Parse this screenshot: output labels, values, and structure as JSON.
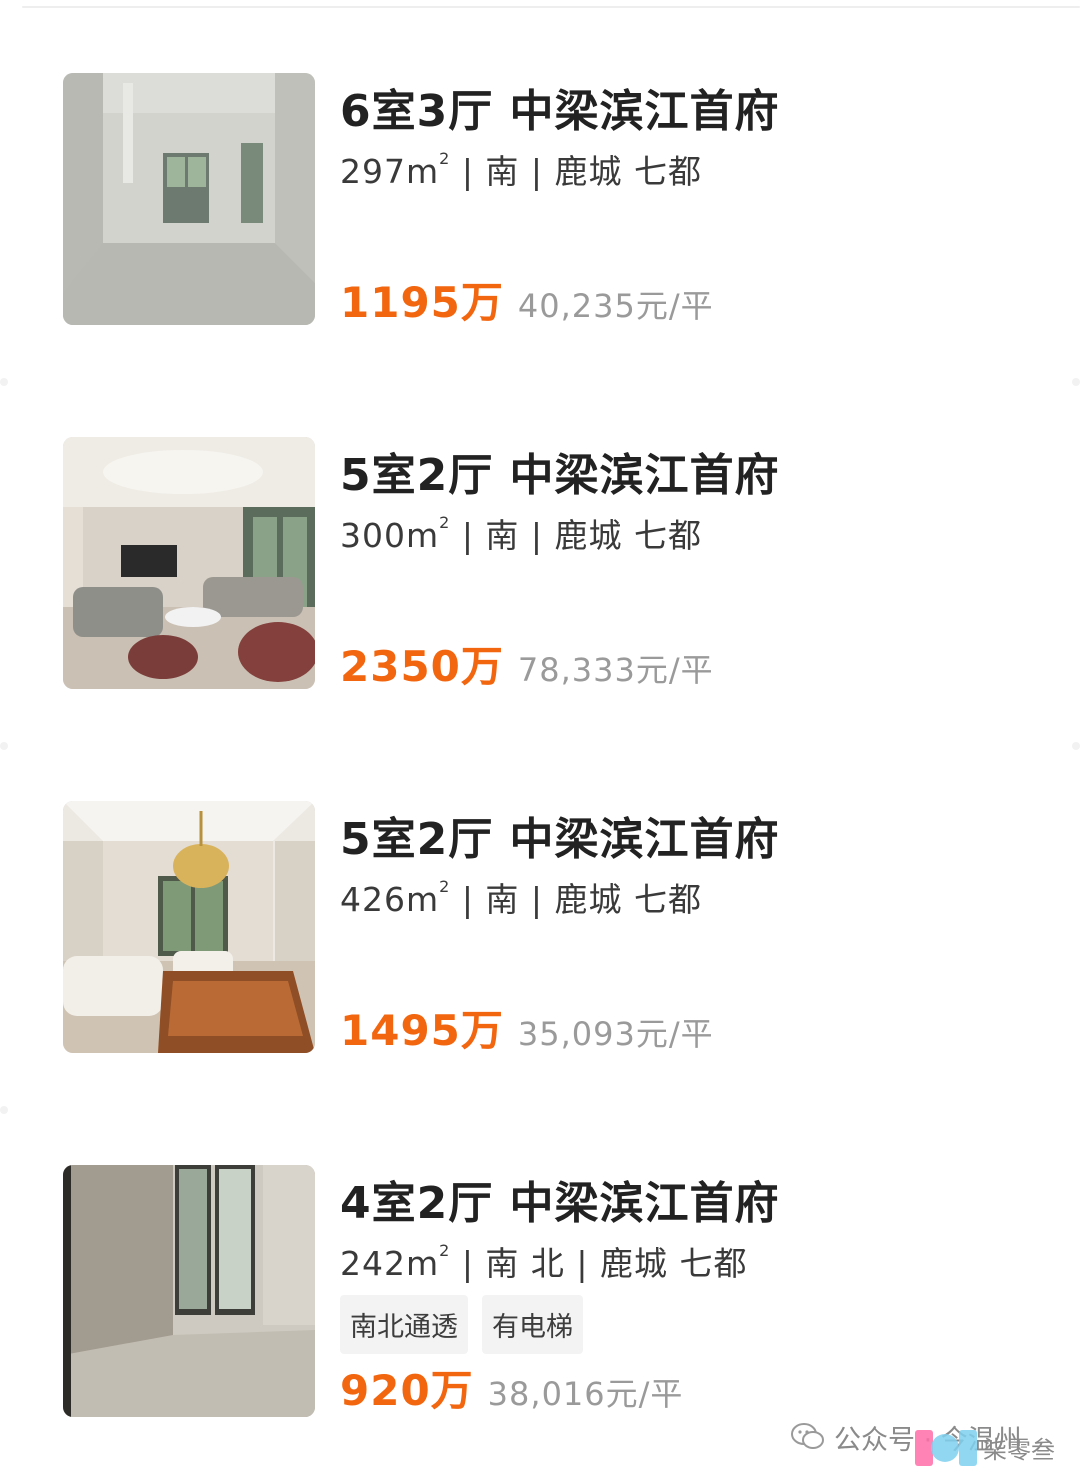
{
  "listings": [
    {
      "title": "6室3厅 中梁滨江首府",
      "area": "297m",
      "area_sup": "2",
      "details": " | 南 | 鹿城 七都",
      "price": "1195万",
      "unit_price": "40,235元/平",
      "photo": "empty-unfinished-room"
    },
    {
      "title": "5室2厅 中梁滨江首府",
      "area": "300m",
      "area_sup": "2",
      "details": " | 南 | 鹿城 七都",
      "price": "2350万",
      "unit_price": "78,333元/平",
      "photo": "furnished-living-room-sofas"
    },
    {
      "title": "5室2厅 中梁滨江首府",
      "area": "426m",
      "area_sup": "2",
      "details": " | 南 | 鹿城 七都",
      "price": "1495万",
      "unit_price": "35,093元/平",
      "photo": "living-room-chandelier"
    },
    {
      "title": "4室2厅 中梁滨江首府",
      "area": "242m",
      "area_sup": "2",
      "details": " | 南 北 | 鹿城 七都",
      "tags": [
        "南北通透",
        "有电梯"
      ],
      "price": "920万",
      "unit_price": "38,016元/平",
      "photo": "empty-room-glass-door"
    }
  ],
  "watermark": {
    "text": "公众号 · 今温州",
    "logo_text": "柒零叁",
    "icon": "wechat-icon"
  },
  "colors": {
    "price": "#f2660f",
    "title": "#222222",
    "unit_price": "#9a9a9a",
    "tag_bg": "#f3f3f3"
  }
}
